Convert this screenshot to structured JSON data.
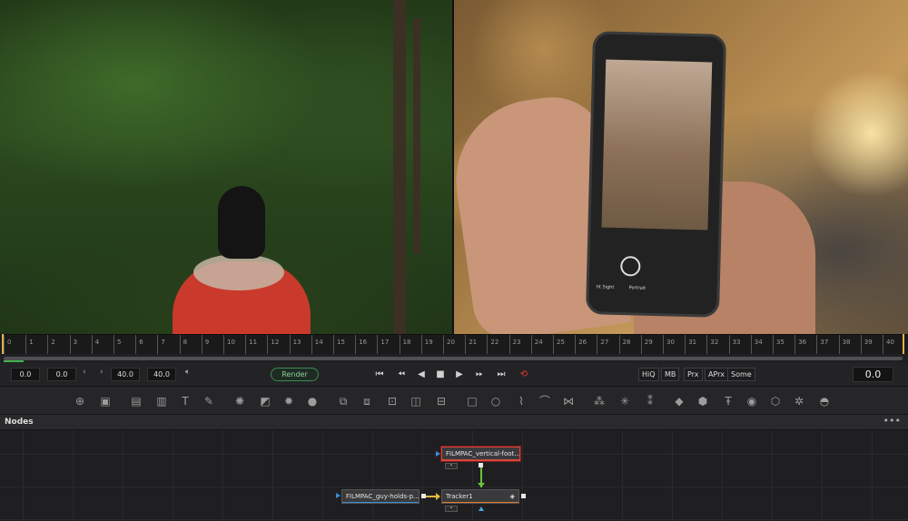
{
  "viewer": {
    "right_phone_modes": [
      "ht Sight",
      "Portrait"
    ]
  },
  "ruler": {
    "ticks": [
      "0",
      "1",
      "2",
      "3",
      "4",
      "5",
      "6",
      "7",
      "8",
      "9",
      "10",
      "11",
      "12",
      "13",
      "14",
      "15",
      "16",
      "17",
      "18",
      "19",
      "20",
      "21",
      "22",
      "23",
      "24",
      "25",
      "26",
      "27",
      "28",
      "29",
      "30",
      "31",
      "32",
      "33",
      "34",
      "35",
      "36",
      "37",
      "38",
      "39",
      "40"
    ]
  },
  "transport": {
    "global_start": "0.0",
    "render_start": "0.0",
    "render_end": "40.0",
    "global_end": "40.0",
    "render_label": "Render",
    "quality_buttons": [
      "HiQ",
      "MB",
      "Prx",
      "APrx",
      "Some"
    ],
    "current_time": "0.0",
    "accent_green": "#3a8b52",
    "loop_color": "#e23b2e"
  },
  "toolbar": {
    "tools": [
      "background-icon",
      "image-icon",
      "text-icon",
      "paint-icon",
      "particles-icon",
      "merge-icon",
      "blur-icon",
      "color-icon",
      "transform-icon",
      "mask-icon",
      "polygon-icon",
      "bspline-icon",
      "tracker-icon",
      "planar-icon",
      "emitter-icon",
      "3d-shape-icon",
      "3d-text-icon",
      "3d-merge-icon",
      "renderer-icon",
      "camera-icon",
      "light-icon",
      "sphere-icon"
    ]
  },
  "nodes_panel": {
    "title": "Nodes",
    "menu": "•••",
    "nodes": [
      {
        "id": "filmpac-vertical",
        "label": "FILMPAC_vertical-foot..."
      },
      {
        "id": "filmpac-guy",
        "label": "FILMPAC_guy-holds-p..."
      },
      {
        "id": "tracker1",
        "label": "Tracker1"
      }
    ],
    "selected_border": "#e0433a"
  }
}
